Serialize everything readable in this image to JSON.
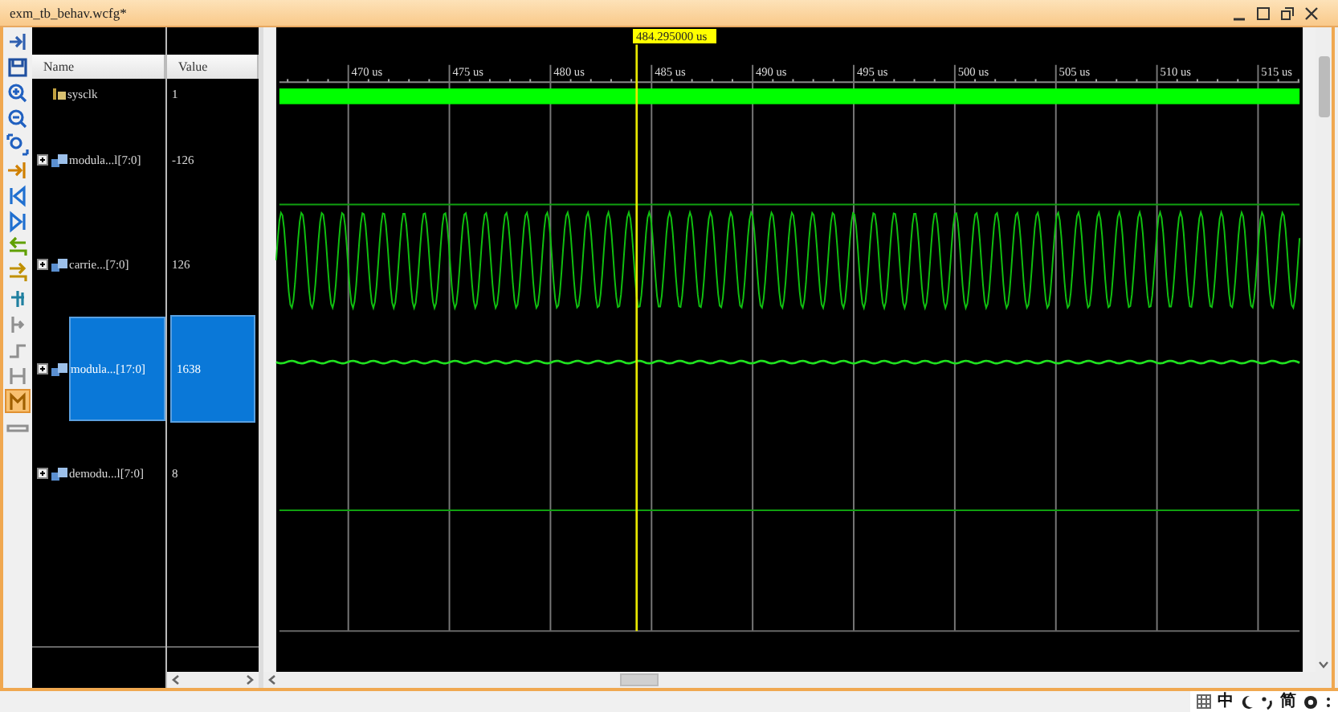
{
  "window": {
    "title": "exm_tb_behav.wcfg*"
  },
  "toolbar": [
    {
      "selected": false
    },
    {
      "selected": false
    },
    {
      "selected": false
    },
    {
      "selected": false
    },
    {
      "selected": false
    },
    {
      "selected": false
    },
    {
      "selected": false
    },
    {
      "selected": false
    },
    {
      "selected": false
    },
    {
      "selected": false
    },
    {
      "selected": false
    },
    {
      "selected": false
    },
    {
      "selected": false
    },
    {
      "selected": false
    },
    {
      "selected": true
    },
    {
      "selected": false
    }
  ],
  "columns": {
    "name": "Name",
    "value": "Value"
  },
  "signals": [
    {
      "kind": "clock",
      "name": "sysclk",
      "value": "1",
      "selected": false
    },
    {
      "kind": "flat",
      "name": "modula...l",
      "width": "[7:0]",
      "value": "-126",
      "selected": false
    },
    {
      "kind": "sine",
      "name": "carrie...",
      "width": "[7:0]",
      "value": "126",
      "selected": false
    },
    {
      "kind": "ripple",
      "name": "modula...",
      "width": "[17:0]",
      "value": "1638",
      "selected": true
    },
    {
      "kind": "flat",
      "name": "demodu...l",
      "width": "[7:0]",
      "value": "8",
      "selected": false
    }
  ],
  "timeline": {
    "cursor": "484.295000 us",
    "ticks": [
      "470 us",
      "475 us",
      "480 us",
      "485 us",
      "490 us",
      "495 us",
      "500 us",
      "505 us",
      "510 us",
      "515 us"
    ]
  },
  "ime_bar": [
    "中",
    "简"
  ]
}
